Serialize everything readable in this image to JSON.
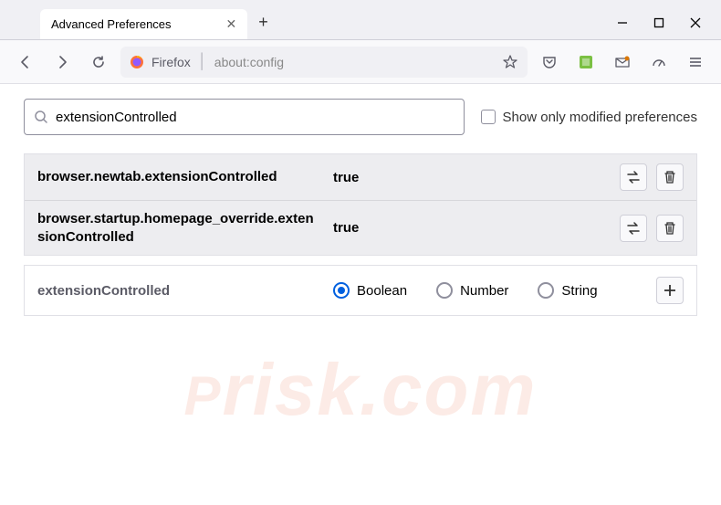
{
  "window": {
    "tab_title": "Advanced Preferences"
  },
  "urlbar": {
    "label": "Firefox",
    "url": "about:config"
  },
  "search": {
    "value": "extensionControlled",
    "checkbox_label": "Show only modified preferences"
  },
  "prefs": [
    {
      "name": "browser.newtab.extensionControlled",
      "value": "true"
    },
    {
      "name": "browser.startup.homepage_override.extensionControlled",
      "value": "true"
    }
  ],
  "newpref": {
    "name": "extensionControlled",
    "types": [
      "Boolean",
      "Number",
      "String"
    ],
    "selected": "Boolean"
  },
  "watermark": "risk.com"
}
